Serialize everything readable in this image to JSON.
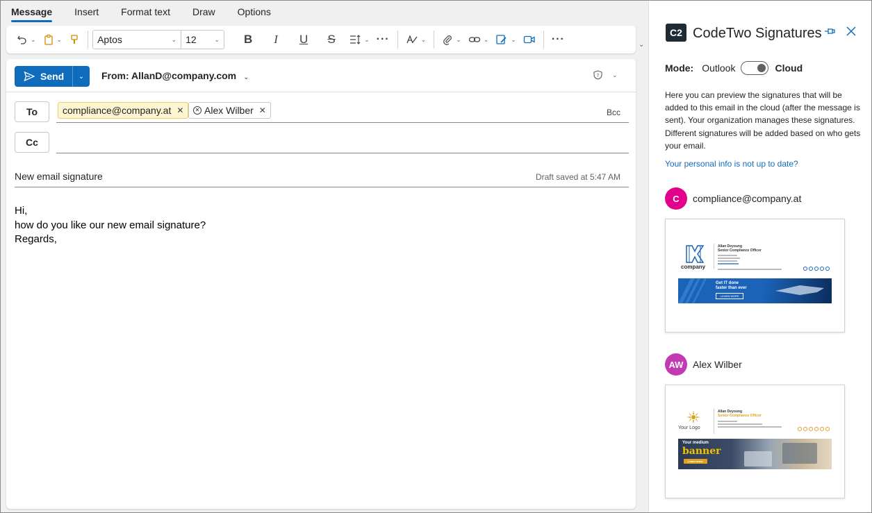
{
  "ribbon": {
    "tabs": [
      "Message",
      "Insert",
      "Format text",
      "Draw",
      "Options"
    ],
    "font": "Aptos",
    "font_size": "12",
    "more_glyph": "···"
  },
  "compose": {
    "send_label": "Send",
    "from_label": "From: AllanD@company.com",
    "to_label": "To",
    "cc_label": "Cc",
    "bcc_label": "Bcc",
    "recipients": [
      "compliance@company.at",
      "Alex Wilber"
    ],
    "subject": "New email signature",
    "draft_status": "Draft saved at 5:47 AM",
    "body_lines": [
      "Hi,",
      "how do you like our new email signature?",
      "Regards,"
    ]
  },
  "pane": {
    "logo_text": "C2",
    "title": "CodeTwo Signatures",
    "mode_label": "Mode:",
    "mode_off": "Outlook",
    "mode_on": "Cloud",
    "toggle_on": true,
    "description": "Here you can preview the signatures that will be added to this email in the cloud (after the message is sent). Your organization manages these signatures. Different signatures will be added based on who gets your email.",
    "link": "Your personal info is not up to date?",
    "recipients": [
      {
        "initials": "C",
        "name": "compliance@company.at",
        "color": "#e3008c"
      },
      {
        "initials": "AW",
        "name": "Alex Wilber",
        "color": "#c239b3"
      }
    ],
    "signatures": [
      {
        "person": "Allan Deyoung",
        "role": "Senior Compliance Officer",
        "logo_text": "company",
        "role_color": "#333333",
        "banner_line1": "Get IT done",
        "banner_line2": "faster than ever",
        "banner_cta": "LEARN MORE",
        "banner_color": "#1a63b8"
      },
      {
        "person": "Allan Deyoung",
        "role": "Senior Compliance Officer",
        "logo_text": "Your Logo",
        "role_color": "#e0a020",
        "banner_line1": "Your medium",
        "banner_line2": "banner",
        "banner_cta": "Learn more",
        "banner_color": "#2b3a55"
      }
    ]
  },
  "colors": {
    "accent": "#0f6cbd",
    "chip_bg": "#fdf6d0",
    "chip_border": "#e8cf6a"
  }
}
